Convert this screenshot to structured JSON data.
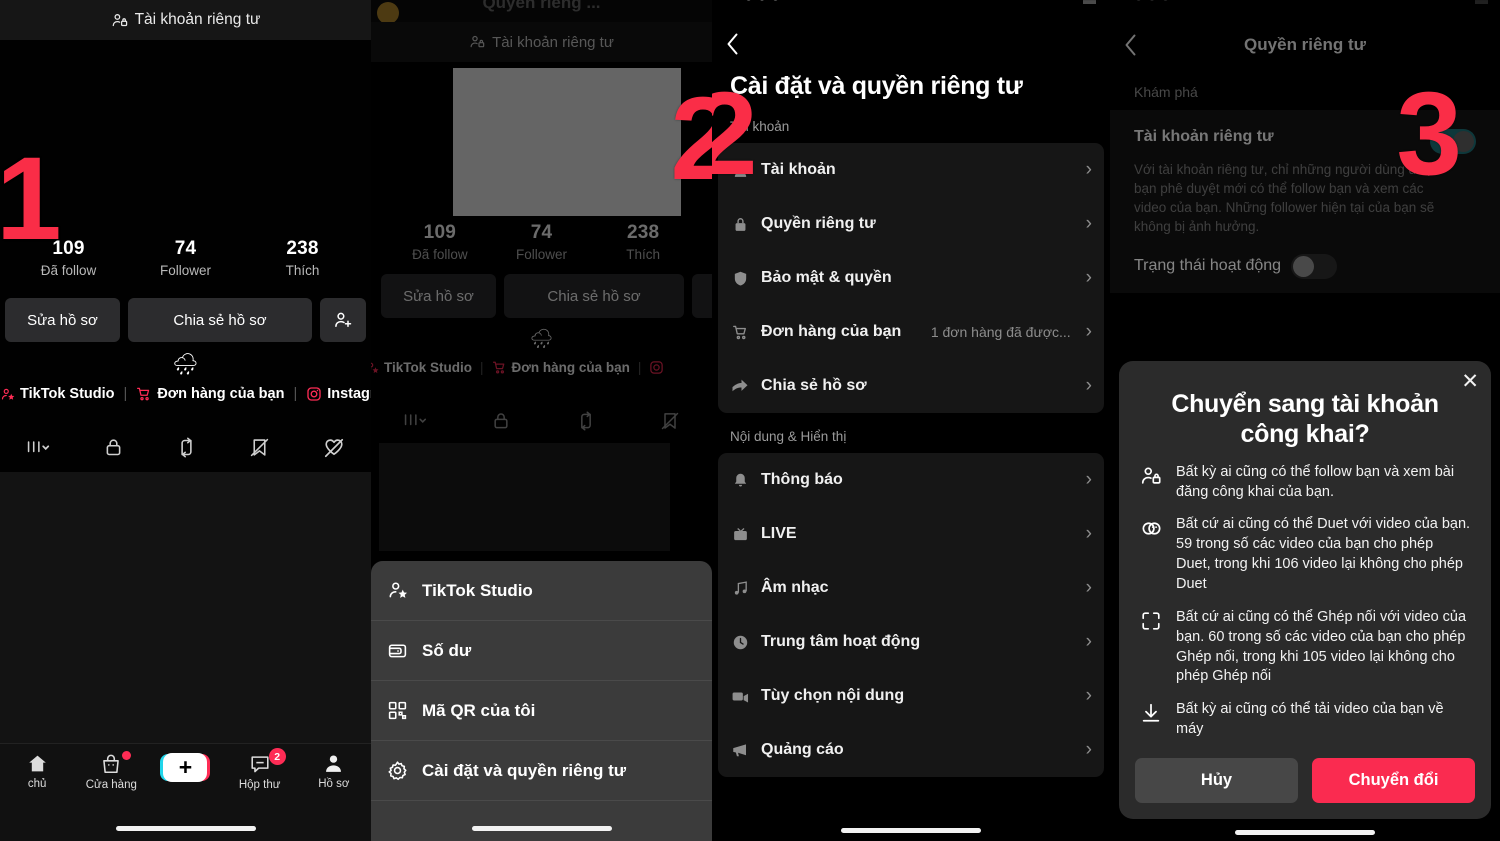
{
  "colors": {
    "accent_red": "#fa2b50",
    "tiktok_pink": "#fe2c55",
    "tiktok_cyan": "#20d5ea",
    "toggle_on": "#1b6b72",
    "sheet_bg": "#3b3b3b",
    "card_bg": "#161616"
  },
  "step_markers": {
    "one": "1",
    "two": "2",
    "three": "3"
  },
  "panel1": {
    "private_header_label": "Tài khoản riêng tư",
    "stats": [
      {
        "number": "109",
        "label": "Đã follow"
      },
      {
        "number": "74",
        "label": "Follower"
      },
      {
        "number": "238",
        "label": "Thích"
      }
    ],
    "buttons": {
      "edit_profile": "Sửa hồ sơ",
      "share_profile": "Chia sẻ hồ sơ",
      "add_friend_icon": "add-person-icon"
    },
    "bio_emoji": "🌧",
    "links": [
      {
        "icon": "person-star-icon",
        "label": "TikTok Studio"
      },
      {
        "icon": "cart-icon",
        "label": "Đơn hàng của bạn"
      },
      {
        "icon": "instagram-icon",
        "label": "Instagram"
      }
    ],
    "content_tabs": [
      "grid-icon",
      "lock-icon",
      "repost-icon",
      "saved-icon",
      "liked-icon"
    ],
    "tabbar": [
      {
        "icon": "home-icon",
        "label": "chủ",
        "badge": ""
      },
      {
        "icon": "shop-icon",
        "label": "Cửa hàng",
        "badge": "dot"
      },
      {
        "icon": "plus-icon",
        "label": "",
        "badge": ""
      },
      {
        "icon": "inbox-icon",
        "label": "Hộp thư",
        "badge": "2"
      },
      {
        "icon": "profile-icon",
        "label": "Hồ sơ",
        "badge": ""
      }
    ]
  },
  "panel2": {
    "ghost_top_title": "Quyền riêng ...",
    "private_header_label": "Tài khoản riêng tư",
    "stats": [
      {
        "number": "109",
        "label": "Đã follow"
      },
      {
        "number": "74",
        "label": "Follower"
      },
      {
        "number": "238",
        "label": "Thích"
      }
    ],
    "buttons": {
      "edit_profile": "Sửa hồ sơ",
      "share_profile": "Chia sẻ hồ sơ"
    },
    "bio_emoji": "🌧",
    "links": [
      {
        "icon": "person-star-icon",
        "label": "TikTok Studio"
      },
      {
        "icon": "cart-icon",
        "label": "Đơn hàng của bạn"
      },
      {
        "icon": "instagram-icon",
        "label": ""
      }
    ],
    "sheet_items": [
      {
        "icon": "person-star-icon",
        "label": "TikTok Studio"
      },
      {
        "icon": "wallet-icon",
        "label": "Số dư"
      },
      {
        "icon": "qr-icon",
        "label": "Mã QR của tôi"
      },
      {
        "icon": "gear-icon",
        "label": "Cài đặt và quyền riêng tư"
      }
    ]
  },
  "panel3": {
    "status_dots": "• • •",
    "back_icon": "chevron-left-icon",
    "title": "Cài đặt và quyền riêng tư",
    "groups": [
      {
        "label": "Tài khoản",
        "rows": [
          {
            "icon": "person-icon",
            "label": "Tài khoản",
            "value": ""
          },
          {
            "icon": "lock-icon",
            "label": "Quyền riêng tư",
            "value": ""
          },
          {
            "icon": "shield-icon",
            "label": "Bảo mật & quyền",
            "value": ""
          },
          {
            "icon": "cart-icon",
            "label": "Đơn hàng của bạn",
            "value": "1 đơn hàng đã được..."
          },
          {
            "icon": "share-arrow-icon",
            "label": "Chia sẻ hồ sơ",
            "value": ""
          }
        ]
      },
      {
        "label": "Nội dung & Hiển thị",
        "rows": [
          {
            "icon": "bell-icon",
            "label": "Thông báo",
            "value": ""
          },
          {
            "icon": "live-icon",
            "label": "LIVE",
            "value": ""
          },
          {
            "icon": "music-icon",
            "label": "Âm nhạc",
            "value": ""
          },
          {
            "icon": "clock-icon",
            "label": "Trung tâm hoạt động",
            "value": ""
          },
          {
            "icon": "video-icon",
            "label": "Tùy chọn nội dung",
            "value": ""
          },
          {
            "icon": "megaphone-icon",
            "label": "Quảng cáo",
            "value": ""
          }
        ]
      }
    ]
  },
  "panel4": {
    "back_icon": "chevron-left-icon",
    "title": "Quyền riêng tư",
    "section_label": "Khám phá",
    "private_account": {
      "label": "Tài khoản riêng tư",
      "toggle_state": "on",
      "description": "Với tài khoản riêng tư, chỉ những người dùng được bạn phê duyệt mới có thể follow bạn và xem các video của bạn. Những follower hiện tại của bạn sẽ không bị ảnh hưởng."
    },
    "activity_status": {
      "label": "Trạng thái hoạt động",
      "toggle_state": "off"
    },
    "modal": {
      "close_icon": "close-icon",
      "title": "Chuyển sang tài khoản công khai?",
      "bullets": [
        {
          "icon": "person-lock-icon",
          "text": "Bất kỳ ai cũng có thể follow bạn và xem bài đăng công khai của bạn."
        },
        {
          "icon": "duet-icon",
          "text": "Bất cứ ai cũng có thể Duet với video của bạn. 59 trong số các video của bạn cho phép Duet, trong khi 106 video lại không cho phép Duet"
        },
        {
          "icon": "stitch-icon",
          "text": "Bất cứ ai cũng có thể Ghép nối với video của bạn. 60 trong số các video của bạn cho phép Ghép nối, trong khi 105 video lại không cho phép Ghép nối"
        },
        {
          "icon": "download-icon",
          "text": "Bất kỳ ai cũng có thể tải video của bạn về máy"
        }
      ],
      "cancel_label": "Hủy",
      "confirm_label": "Chuyển đổi"
    }
  }
}
